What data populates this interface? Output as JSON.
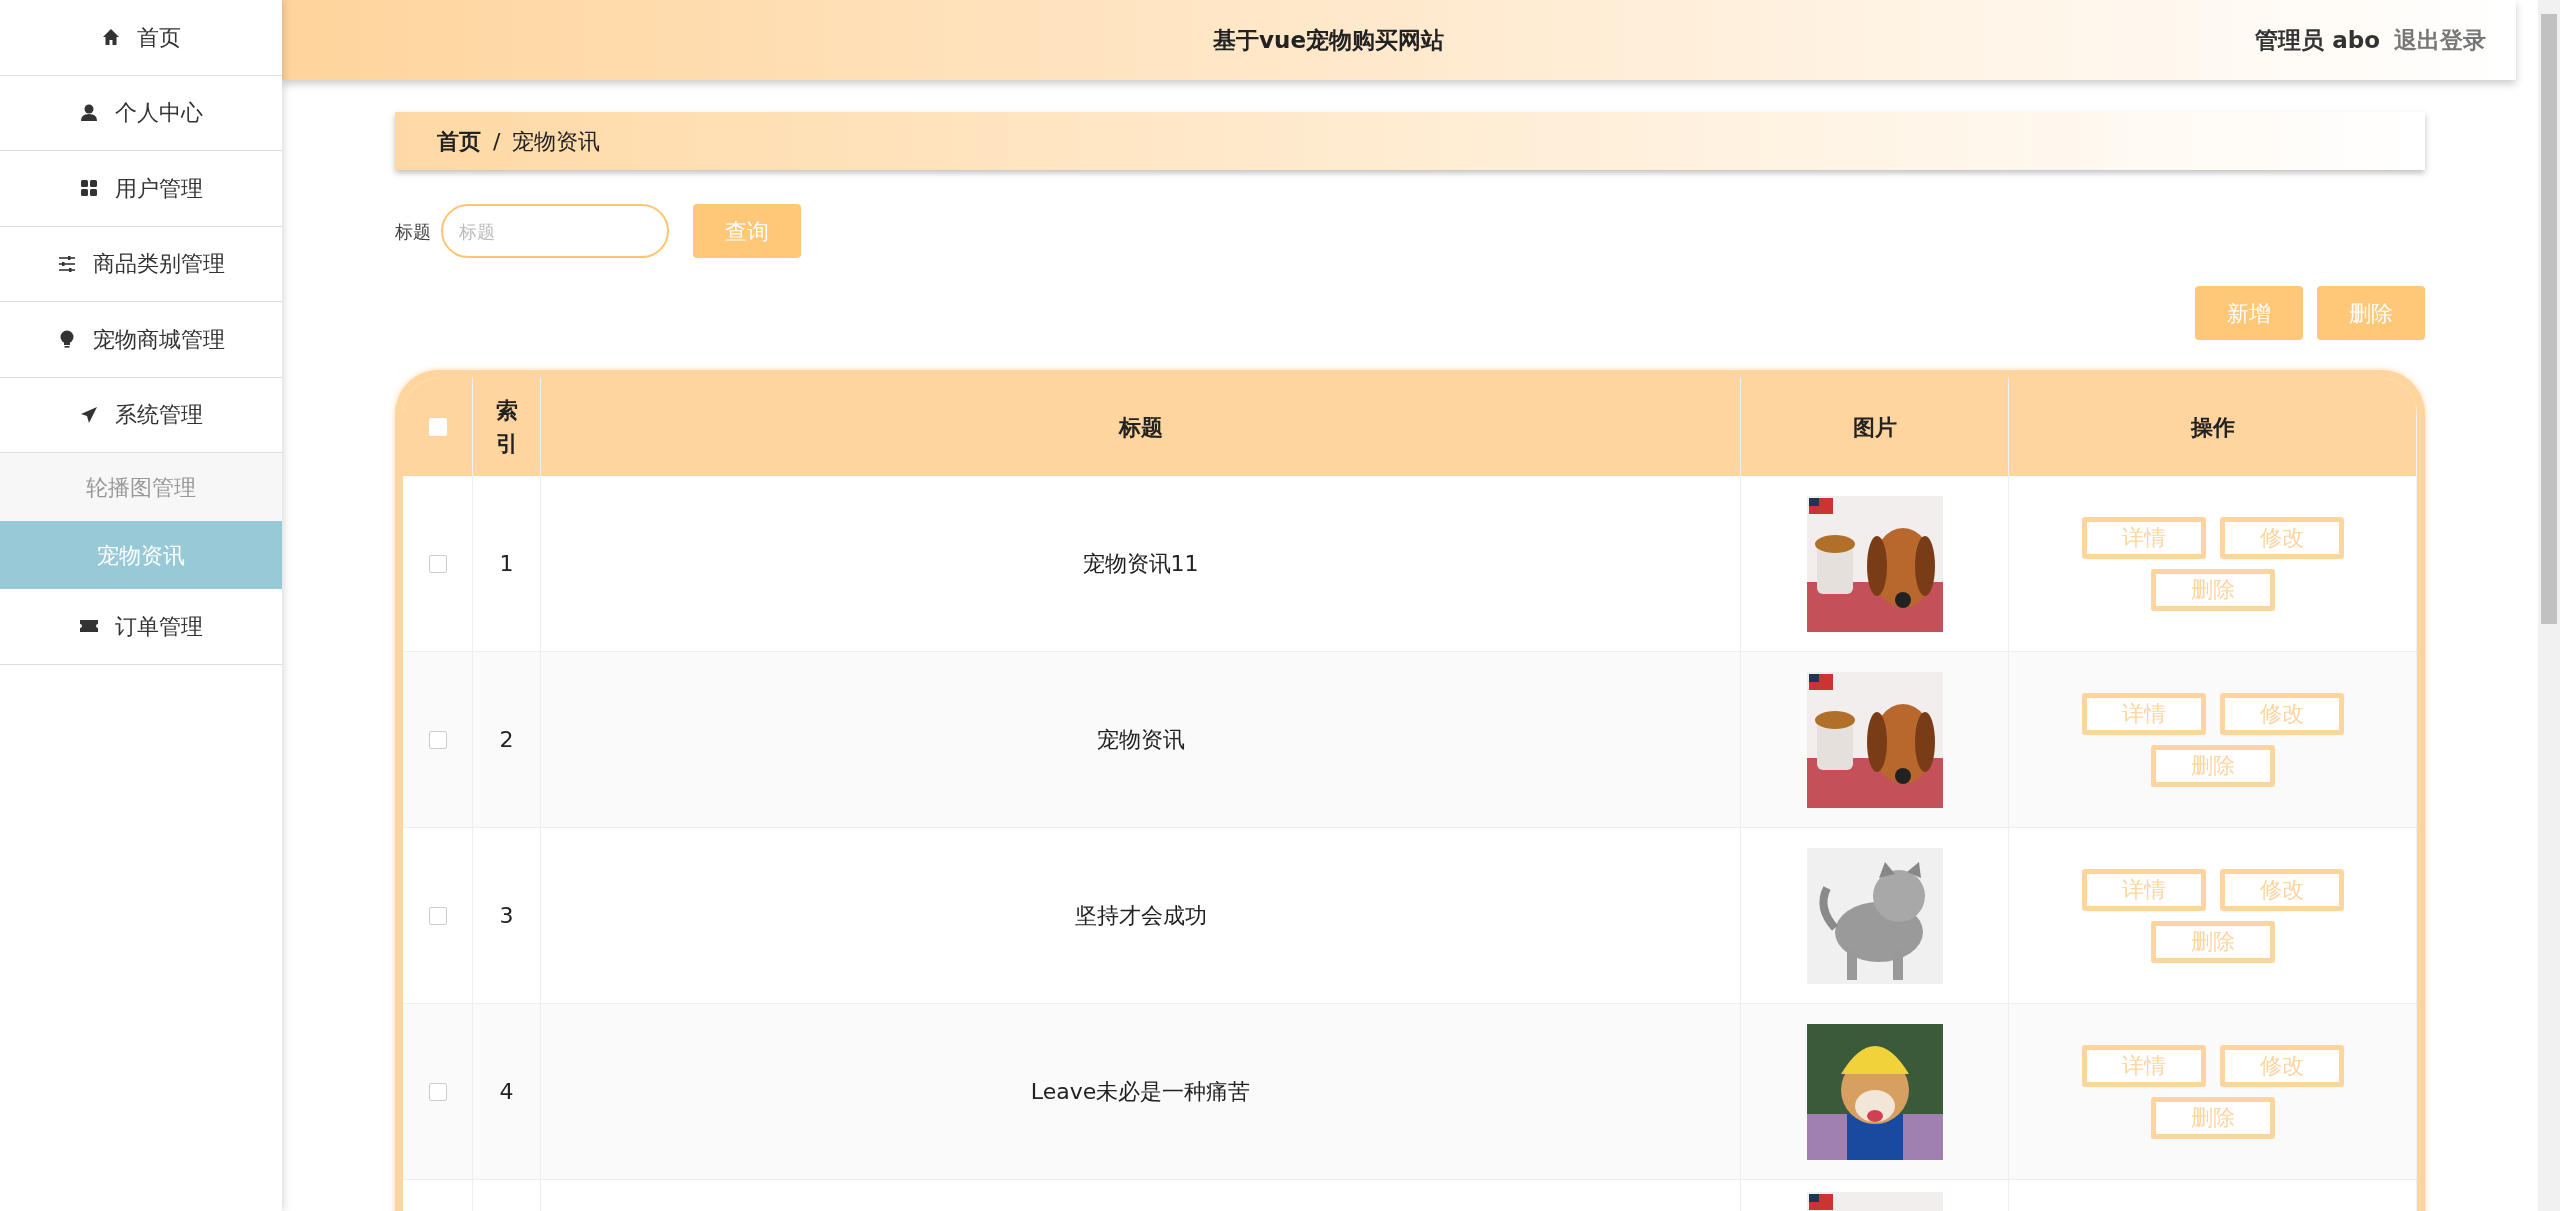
{
  "sidebar": {
    "items": [
      {
        "label": "首页"
      },
      {
        "label": "个人中心"
      },
      {
        "label": "用户管理"
      },
      {
        "label": "商品类别管理"
      },
      {
        "label": "宠物商城管理"
      },
      {
        "label": "系统管理",
        "children": [
          {
            "label": "轮播图管理",
            "selected": false
          },
          {
            "label": "宠物资讯",
            "selected": true
          }
        ]
      },
      {
        "label": "订单管理"
      }
    ]
  },
  "header": {
    "title": "基于vue宠物购买网站",
    "user": "管理员 abo",
    "logout": "退出登录"
  },
  "breadcrumb": {
    "items": [
      "首页",
      "宠物资讯"
    ],
    "separator": "/"
  },
  "search": {
    "label": "标题",
    "placeholder": "标题",
    "button": "查询"
  },
  "actions": [
    "新增",
    "删除"
  ],
  "table": {
    "header_checkbox": {
      "checked": false
    },
    "columns": [
      "索引",
      "标题",
      "图片",
      "操作"
    ],
    "rows": [
      {
        "checked": false,
        "index": "1",
        "title": "宠物资讯11",
        "picture": {
          "kind": "picture"
        },
        "buttons": [
          "详情",
          "修改",
          "删除"
        ]
      },
      {
        "checked": false,
        "index": "2",
        "title": "宠物资讯",
        "picture": {
          "kind": "picture"
        },
        "buttons": [
          "详情",
          "修改",
          "删除"
        ]
      },
      {
        "checked": false,
        "index": "3",
        "title": "坚持才会成功",
        "picture": {
          "kind": "picture"
        },
        "buttons": [
          "详情",
          "修改",
          "删除"
        ]
      },
      {
        "checked": false,
        "index": "4",
        "title": "Leave未必是一种痛苦",
        "picture": {
          "kind": "picture"
        },
        "buttons": [
          "详情",
          "修改",
          "删除"
        ]
      },
      {
        "picture": {
          "kind": "picture"
        }
      }
    ]
  }
}
